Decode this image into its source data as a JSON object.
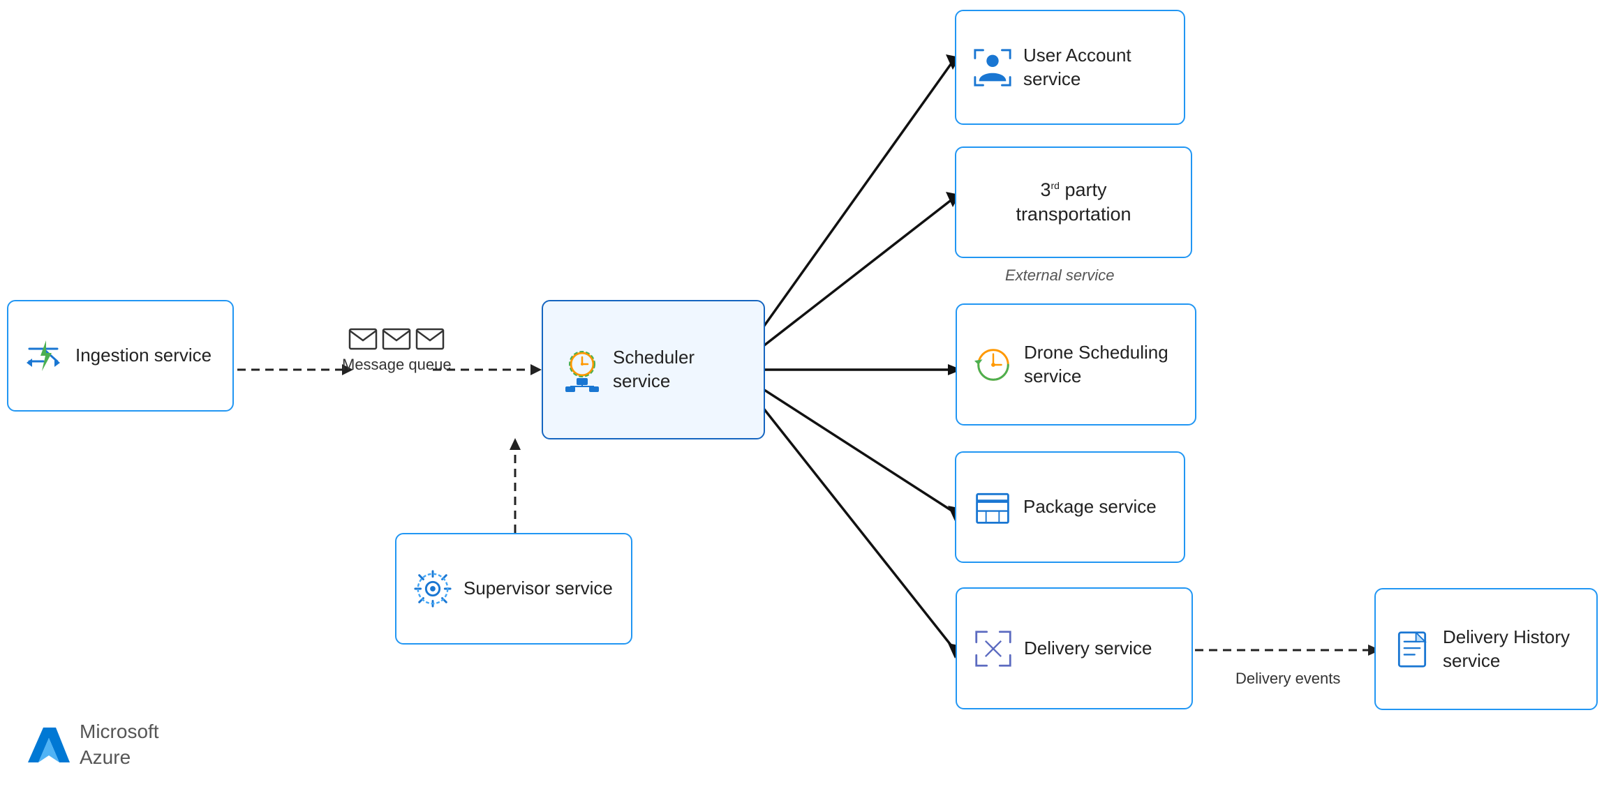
{
  "services": {
    "ingestion": {
      "label": "Ingestion\nservice",
      "id": "ingestion-service"
    },
    "scheduler": {
      "label": "Scheduler\nservice",
      "id": "scheduler-service"
    },
    "supervisor": {
      "label": "Supervisor\nservice",
      "id": "supervisor-service"
    },
    "user_account": {
      "label": "User\nAccount\nservice",
      "id": "user-account-service"
    },
    "third_party": {
      "label": "3rd party\ntransportation",
      "id": "third-party-service"
    },
    "third_party_sub": {
      "label": "External service",
      "id": "external-service-label"
    },
    "drone": {
      "label": "Drone\nScheduling\nservice",
      "id": "drone-scheduling-service"
    },
    "package": {
      "label": "Package\nservice",
      "id": "package-service"
    },
    "delivery": {
      "label": "Delivery\nservice",
      "id": "delivery-service"
    },
    "delivery_history": {
      "label": "Delivery\nHistory\nservice",
      "id": "delivery-history-service"
    }
  },
  "labels": {
    "message_queue": "Message\nqueue",
    "delivery_events": "Delivery events",
    "external_service": "External service"
  },
  "colors": {
    "blue": "#1976D2",
    "light_blue": "#2196F3",
    "border": "#42A5F5",
    "dark": "#1565C0"
  }
}
